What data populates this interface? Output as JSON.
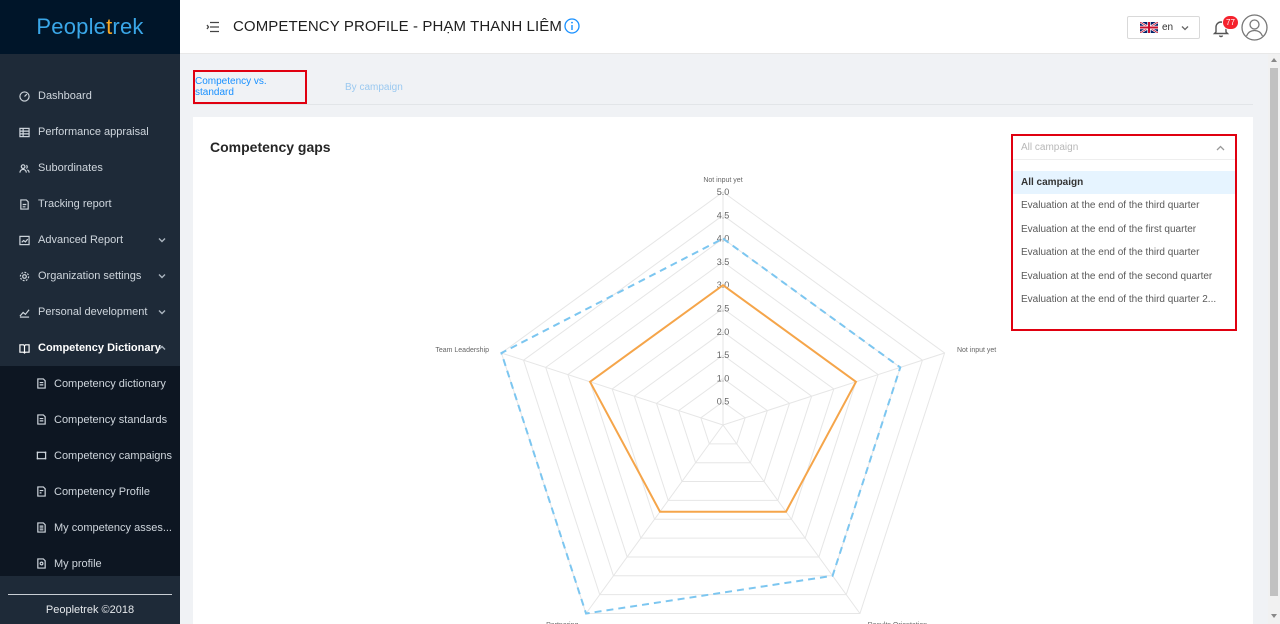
{
  "brand": {
    "logo_text_a": "People",
    "logo_text_b": "t",
    "logo_text_c": "rek"
  },
  "sidebar": {
    "items": [
      {
        "label": "Dashboard",
        "icon": "dashboard-icon"
      },
      {
        "label": "Performance appraisal",
        "icon": "table-icon"
      },
      {
        "label": "Subordinates",
        "icon": "users-icon"
      },
      {
        "label": "Tracking report",
        "icon": "report-icon"
      },
      {
        "label": "Advanced Report",
        "icon": "chart-icon",
        "expandable": true
      },
      {
        "label": "Organization settings",
        "icon": "gear-icon",
        "expandable": true
      },
      {
        "label": "Personal development",
        "icon": "trend-icon",
        "expandable": true
      },
      {
        "label": "Competency Dictionary",
        "icon": "book-icon",
        "expandable": true,
        "open": true
      }
    ],
    "sub_items": [
      {
        "label": "Competency dictionary"
      },
      {
        "label": "Competency standards"
      },
      {
        "label": "Competency campaigns"
      },
      {
        "label": "Competency Profile"
      },
      {
        "label": "My competency asses..."
      },
      {
        "label": "My profile"
      }
    ],
    "footer": "Peopletrek ©2018"
  },
  "header": {
    "title": "COMPETENCY PROFILE - PHẠM THANH LIÊM",
    "language": "en",
    "notification_count": "77"
  },
  "tabs": [
    {
      "label": "Competency vs. standard",
      "active": true
    },
    {
      "label": "By campaign",
      "active": false
    }
  ],
  "card": {
    "title": "Competency gaps",
    "campaign_select": {
      "placeholder": "All campaign",
      "options": [
        "All campaign",
        "Evaluation at the end of the third quarter",
        "Evaluation at the end of the first quarter",
        "Evaluation at the end of the third quarter",
        "Evaluation at the end of the second quarter",
        "Evaluation at the end of the third quarter 2..."
      ],
      "selected_index": 0
    }
  },
  "chart_data": {
    "type": "radar",
    "axes": [
      "Not input yet",
      "Not input yet",
      "Results Orientation",
      "Partnering",
      "Team Leadership"
    ],
    "rmax": 5,
    "ticks": [
      "0.5",
      "1.0",
      "1.5",
      "2.0",
      "2.5",
      "3.0",
      "3.5",
      "4.0",
      "4.5",
      "5.0"
    ],
    "series": [
      {
        "values": [
          4,
          4,
          4,
          5,
          5
        ],
        "color": "#7cc6f0",
        "style": "dashed"
      },
      {
        "values": [
          3,
          3,
          2.3,
          2.3,
          3
        ],
        "color": "#f5a54a",
        "style": "solid"
      }
    ]
  }
}
